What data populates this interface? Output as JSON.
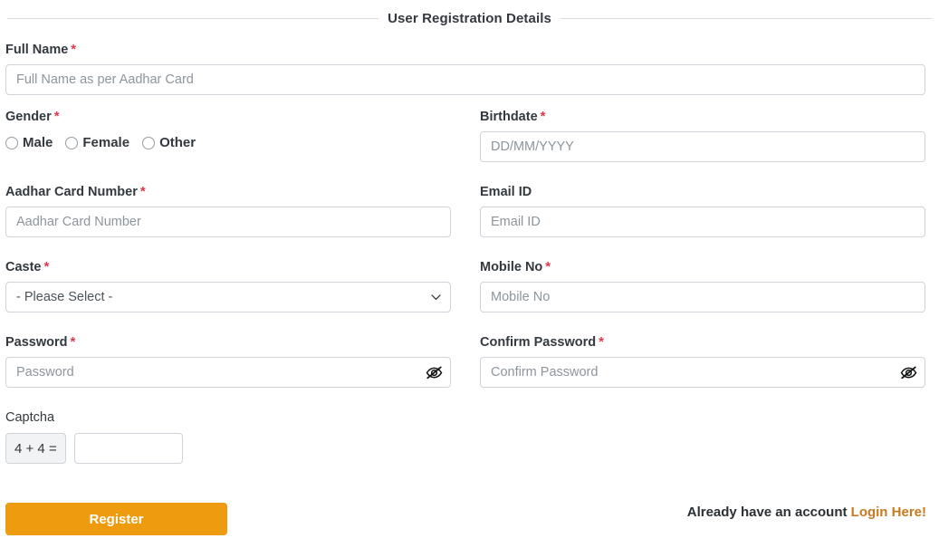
{
  "section": {
    "title": "User Registration Details"
  },
  "fields": {
    "full_name": {
      "label": "Full Name",
      "required": "*",
      "placeholder": "Full Name as per Aadhar Card",
      "value": ""
    },
    "gender": {
      "label": "Gender",
      "required": "*",
      "options": [
        "Male",
        "Female",
        "Other"
      ],
      "selected": ""
    },
    "birthdate": {
      "label": "Birthdate",
      "required": "*",
      "placeholder": "DD/MM/YYYY",
      "value": ""
    },
    "aadhar": {
      "label": "Aadhar Card Number",
      "required": "*",
      "placeholder": "Aadhar Card Number",
      "value": ""
    },
    "email": {
      "label": "Email ID",
      "required": "",
      "placeholder": "Email ID",
      "value": ""
    },
    "caste": {
      "label": "Caste",
      "required": "*",
      "selected": "- Please Select -",
      "options": [
        "- Please Select -"
      ]
    },
    "mobile": {
      "label": "Mobile No",
      "required": "*",
      "placeholder": "Mobile No",
      "value": ""
    },
    "password": {
      "label": "Password",
      "required": "*",
      "placeholder": "Password",
      "value": "",
      "toggle_icon": "eye-slash-icon"
    },
    "confirm_password": {
      "label": "Confirm Password",
      "required": "*",
      "placeholder": "Confirm Password",
      "value": "",
      "toggle_icon": "eye-slash-icon"
    },
    "captcha": {
      "label": "Captcha",
      "question": "4 + 4 =",
      "placeholder": "",
      "value": ""
    }
  },
  "footer": {
    "register_label": "Register",
    "account_text": "Already have an account",
    "login_link": "Login Here!"
  },
  "colors": {
    "accent": "#ee9b10",
    "required": "#e03a4e",
    "link": "#c57a1f",
    "text": "#33393f",
    "border": "#ced4da"
  }
}
